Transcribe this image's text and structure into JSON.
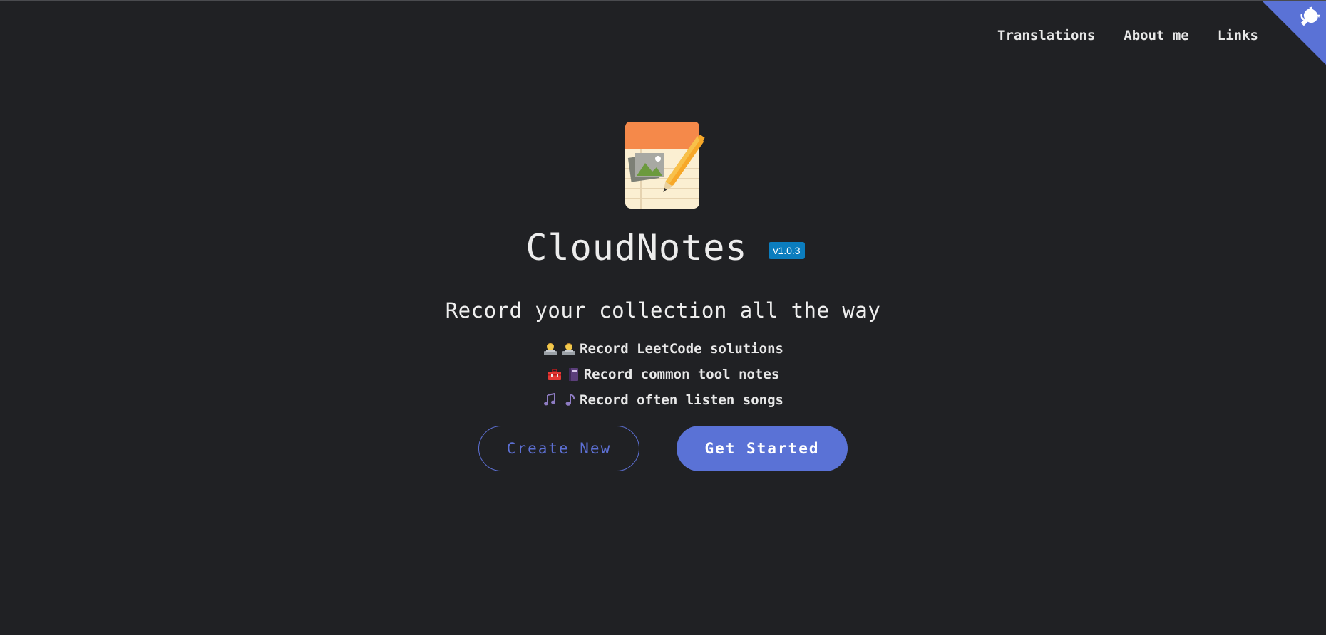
{
  "nav": {
    "items": [
      {
        "label": "Translations"
      },
      {
        "label": "About me"
      },
      {
        "label": "Links"
      }
    ]
  },
  "corner": {
    "icon": "github-octocat-icon",
    "color": "#5a72d6"
  },
  "hero": {
    "title": "CloudNotes",
    "version": "v1.0.3",
    "tagline": "Record your collection all the way",
    "features": [
      {
        "icons": [
          "technologist-icon",
          "technologist-icon"
        ],
        "label": "Record LeetCode solutions"
      },
      {
        "icons": [
          "toolbox-icon",
          "notebook-icon"
        ],
        "label": "Record common tool notes"
      },
      {
        "icons": [
          "musical-notes-icon",
          "musical-note-icon"
        ],
        "label": "Record often listen songs"
      }
    ],
    "buttons": {
      "secondary": "Create New",
      "primary": "Get Started"
    }
  },
  "colors": {
    "background": "#202124",
    "accent": "#5a72d6",
    "badge": "#0b7dbe"
  }
}
